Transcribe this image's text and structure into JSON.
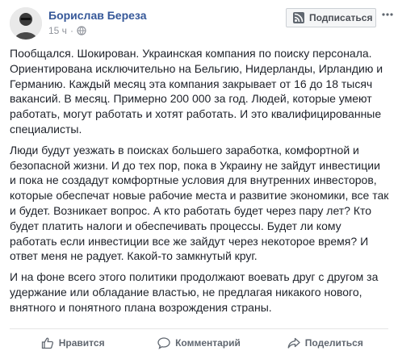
{
  "author": {
    "name": "Борислав Береза",
    "time": "15 ч",
    "separator": "·",
    "audience_icon": "globe-icon"
  },
  "subscribe": {
    "label": "Подписаться",
    "icon": "rss-icon"
  },
  "more_icon": "more-options-icon",
  "post": {
    "paragraphs": [
      "Пообщался. Шокирован. Украинская компания по поиску персонала. Ориентирована исключительно на Бельгию, Нидерланды, Ирландию и Германию. Каждый месяц эта компания закрывает от 16 до 18 тысяч вакансий. В месяц. Примерно 200 000 за год. Людей, которые умеют работать, могут работать и хотят работать. И это квалифицированные специалисты.",
      "Люди будут уезжать в поисках большего заработка, комфортной и безопасной жизни. И до тех пор, пока в Украину не зайдут инвестиции и пока не создадут комфортные условия для внутренних инвесторов, которые обеспечат новые рабочие места и развитие экономики, все так и будет. Возникает вопрос. А кто работать будет через пару лет? Кто будет платить налоги и обеспечивать процессы. Будет ли кому работать если инвестиции все же зайдут через некоторое время? И ответ меня не радует. Какой-то замкнутый круг.",
      "И на фоне всего этого политики продолжают воевать друг с другом за удержание или обладание властью, не предлагая никакого нового, внятного и понятного плана возрождения страны."
    ]
  },
  "actions": {
    "like": {
      "label": "Нравится",
      "icon": "thumbs-up-icon"
    },
    "comment": {
      "label": "Комментарий",
      "icon": "comment-icon"
    },
    "share": {
      "label": "Поделиться",
      "icon": "share-icon"
    }
  },
  "colors": {
    "author_link": "#365899",
    "text": "#1d2129",
    "meta": "#90949c",
    "action_text": "#606770"
  }
}
